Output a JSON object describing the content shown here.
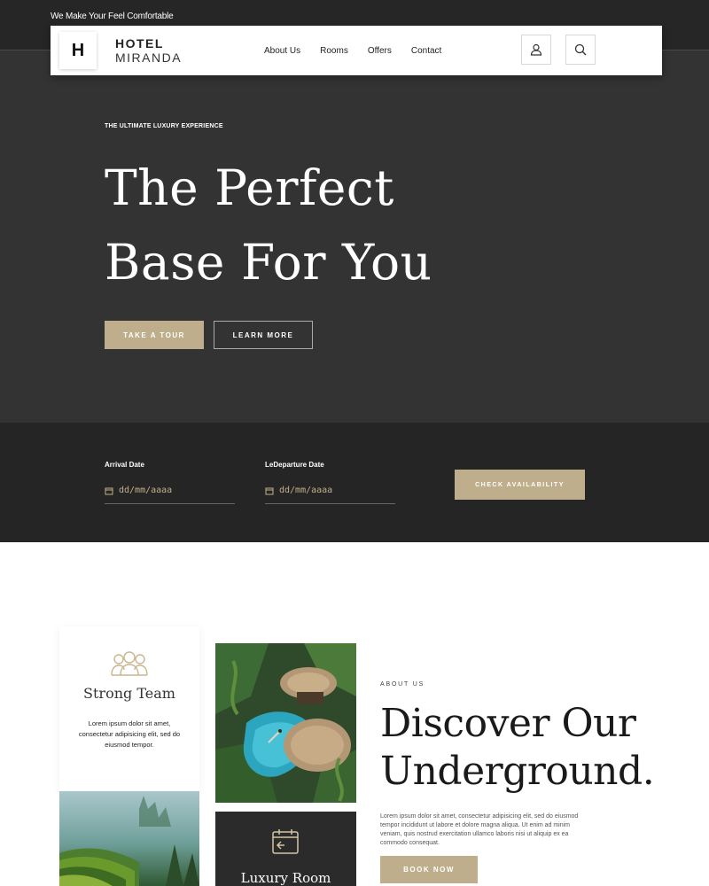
{
  "topbar": {
    "tagline": "We Make Your Feel Comfortable"
  },
  "navbar": {
    "logo_letter": "H",
    "brand_line1": "HOTEL",
    "brand_line2": "MIRANDA",
    "links": [
      "About Us",
      "Rooms",
      "Offers",
      "Contact"
    ],
    "icons": [
      "user-icon",
      "search-icon"
    ]
  },
  "hero": {
    "eyebrow": "THE ULTIMATE LUXURY EXPERIENCE",
    "headline_line1": "The Perfect",
    "headline_line2": "Base For You",
    "primary_button": "TAKE A TOUR",
    "secondary_button": "LEARN MORE"
  },
  "booking": {
    "arrival_label": "Arrival Date",
    "arrival_placeholder": "dd/mm/aaaa",
    "departure_label": "LeDeparture Date",
    "departure_placeholder": "dd/mm/aaaa",
    "check_button": "CHECK AVAILABILITY"
  },
  "about": {
    "team_title": "Strong Team",
    "team_text": "Lorem ipsum dolor sit amet, consectetur adipisicing elit, sed do eiusmod tempor.",
    "room_title": "Luxury Room",
    "eyebrow": "ABOUT US",
    "title_line1": "Discover Our",
    "title_line2": "Underground.",
    "body": "Lorem ipsum dolor sit amet, consectetur adipisicing elit, sed do eiusmod tempor incididunt ut labore et dolore magna aliqua. Ut enim ad minim veniam, quis nostrud exercitation ullamco laboris nisi ut aliquip ex ea commodo consequat.",
    "book_button": "BOOK NOW"
  },
  "colors": {
    "accent": "#bfae8b",
    "hero_bg": "#333333",
    "dark_bg": "#262626"
  }
}
